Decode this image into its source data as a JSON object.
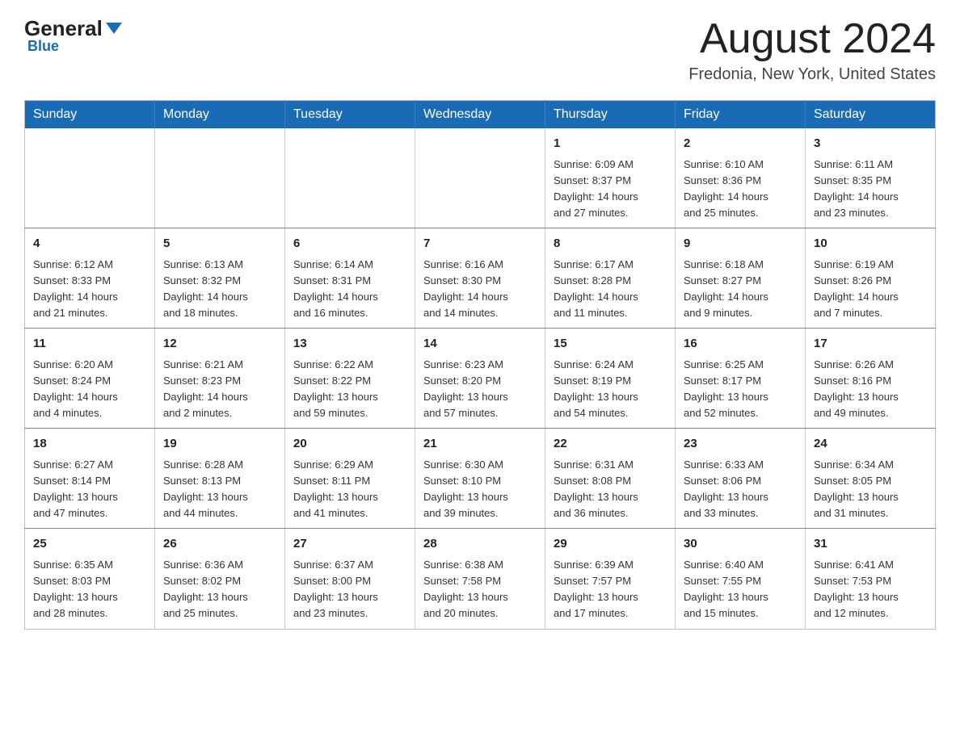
{
  "header": {
    "logo_general": "General",
    "logo_blue": "Blue",
    "month_title": "August 2024",
    "location": "Fredonia, New York, United States"
  },
  "days_of_week": [
    "Sunday",
    "Monday",
    "Tuesday",
    "Wednesday",
    "Thursday",
    "Friday",
    "Saturday"
  ],
  "weeks": [
    [
      {
        "day": "",
        "info": ""
      },
      {
        "day": "",
        "info": ""
      },
      {
        "day": "",
        "info": ""
      },
      {
        "day": "",
        "info": ""
      },
      {
        "day": "1",
        "info": "Sunrise: 6:09 AM\nSunset: 8:37 PM\nDaylight: 14 hours\nand 27 minutes."
      },
      {
        "day": "2",
        "info": "Sunrise: 6:10 AM\nSunset: 8:36 PM\nDaylight: 14 hours\nand 25 minutes."
      },
      {
        "day": "3",
        "info": "Sunrise: 6:11 AM\nSunset: 8:35 PM\nDaylight: 14 hours\nand 23 minutes."
      }
    ],
    [
      {
        "day": "4",
        "info": "Sunrise: 6:12 AM\nSunset: 8:33 PM\nDaylight: 14 hours\nand 21 minutes."
      },
      {
        "day": "5",
        "info": "Sunrise: 6:13 AM\nSunset: 8:32 PM\nDaylight: 14 hours\nand 18 minutes."
      },
      {
        "day": "6",
        "info": "Sunrise: 6:14 AM\nSunset: 8:31 PM\nDaylight: 14 hours\nand 16 minutes."
      },
      {
        "day": "7",
        "info": "Sunrise: 6:16 AM\nSunset: 8:30 PM\nDaylight: 14 hours\nand 14 minutes."
      },
      {
        "day": "8",
        "info": "Sunrise: 6:17 AM\nSunset: 8:28 PM\nDaylight: 14 hours\nand 11 minutes."
      },
      {
        "day": "9",
        "info": "Sunrise: 6:18 AM\nSunset: 8:27 PM\nDaylight: 14 hours\nand 9 minutes."
      },
      {
        "day": "10",
        "info": "Sunrise: 6:19 AM\nSunset: 8:26 PM\nDaylight: 14 hours\nand 7 minutes."
      }
    ],
    [
      {
        "day": "11",
        "info": "Sunrise: 6:20 AM\nSunset: 8:24 PM\nDaylight: 14 hours\nand 4 minutes."
      },
      {
        "day": "12",
        "info": "Sunrise: 6:21 AM\nSunset: 8:23 PM\nDaylight: 14 hours\nand 2 minutes."
      },
      {
        "day": "13",
        "info": "Sunrise: 6:22 AM\nSunset: 8:22 PM\nDaylight: 13 hours\nand 59 minutes."
      },
      {
        "day": "14",
        "info": "Sunrise: 6:23 AM\nSunset: 8:20 PM\nDaylight: 13 hours\nand 57 minutes."
      },
      {
        "day": "15",
        "info": "Sunrise: 6:24 AM\nSunset: 8:19 PM\nDaylight: 13 hours\nand 54 minutes."
      },
      {
        "day": "16",
        "info": "Sunrise: 6:25 AM\nSunset: 8:17 PM\nDaylight: 13 hours\nand 52 minutes."
      },
      {
        "day": "17",
        "info": "Sunrise: 6:26 AM\nSunset: 8:16 PM\nDaylight: 13 hours\nand 49 minutes."
      }
    ],
    [
      {
        "day": "18",
        "info": "Sunrise: 6:27 AM\nSunset: 8:14 PM\nDaylight: 13 hours\nand 47 minutes."
      },
      {
        "day": "19",
        "info": "Sunrise: 6:28 AM\nSunset: 8:13 PM\nDaylight: 13 hours\nand 44 minutes."
      },
      {
        "day": "20",
        "info": "Sunrise: 6:29 AM\nSunset: 8:11 PM\nDaylight: 13 hours\nand 41 minutes."
      },
      {
        "day": "21",
        "info": "Sunrise: 6:30 AM\nSunset: 8:10 PM\nDaylight: 13 hours\nand 39 minutes."
      },
      {
        "day": "22",
        "info": "Sunrise: 6:31 AM\nSunset: 8:08 PM\nDaylight: 13 hours\nand 36 minutes."
      },
      {
        "day": "23",
        "info": "Sunrise: 6:33 AM\nSunset: 8:06 PM\nDaylight: 13 hours\nand 33 minutes."
      },
      {
        "day": "24",
        "info": "Sunrise: 6:34 AM\nSunset: 8:05 PM\nDaylight: 13 hours\nand 31 minutes."
      }
    ],
    [
      {
        "day": "25",
        "info": "Sunrise: 6:35 AM\nSunset: 8:03 PM\nDaylight: 13 hours\nand 28 minutes."
      },
      {
        "day": "26",
        "info": "Sunrise: 6:36 AM\nSunset: 8:02 PM\nDaylight: 13 hours\nand 25 minutes."
      },
      {
        "day": "27",
        "info": "Sunrise: 6:37 AM\nSunset: 8:00 PM\nDaylight: 13 hours\nand 23 minutes."
      },
      {
        "day": "28",
        "info": "Sunrise: 6:38 AM\nSunset: 7:58 PM\nDaylight: 13 hours\nand 20 minutes."
      },
      {
        "day": "29",
        "info": "Sunrise: 6:39 AM\nSunset: 7:57 PM\nDaylight: 13 hours\nand 17 minutes."
      },
      {
        "day": "30",
        "info": "Sunrise: 6:40 AM\nSunset: 7:55 PM\nDaylight: 13 hours\nand 15 minutes."
      },
      {
        "day": "31",
        "info": "Sunrise: 6:41 AM\nSunset: 7:53 PM\nDaylight: 13 hours\nand 12 minutes."
      }
    ]
  ]
}
